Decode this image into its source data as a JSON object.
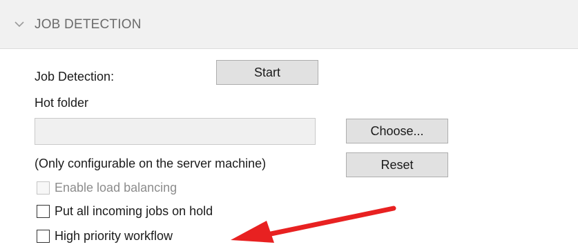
{
  "section": {
    "title": "JOB DETECTION"
  },
  "job_detection": {
    "label": "Job Detection:",
    "start_button": "Start"
  },
  "hot_folder": {
    "label": "Hot folder",
    "path_value": "",
    "choose_button": "Choose...",
    "note": "(Only configurable on the server machine)",
    "reset_button": "Reset"
  },
  "options": {
    "load_balancing": {
      "label": "Enable load balancing",
      "checked": false,
      "enabled": false
    },
    "hold_incoming": {
      "label": "Put all incoming jobs on hold",
      "checked": false,
      "enabled": true
    },
    "high_priority": {
      "label": "High priority workflow",
      "checked": false,
      "enabled": true
    }
  },
  "colors": {
    "header_bg": "#f1f1f1",
    "button_bg": "#e1e1e1",
    "annotation_arrow": "#e82121"
  },
  "icons": {
    "section_toggle": "chevron-down-icon",
    "annotation": "red-arrow-icon"
  }
}
